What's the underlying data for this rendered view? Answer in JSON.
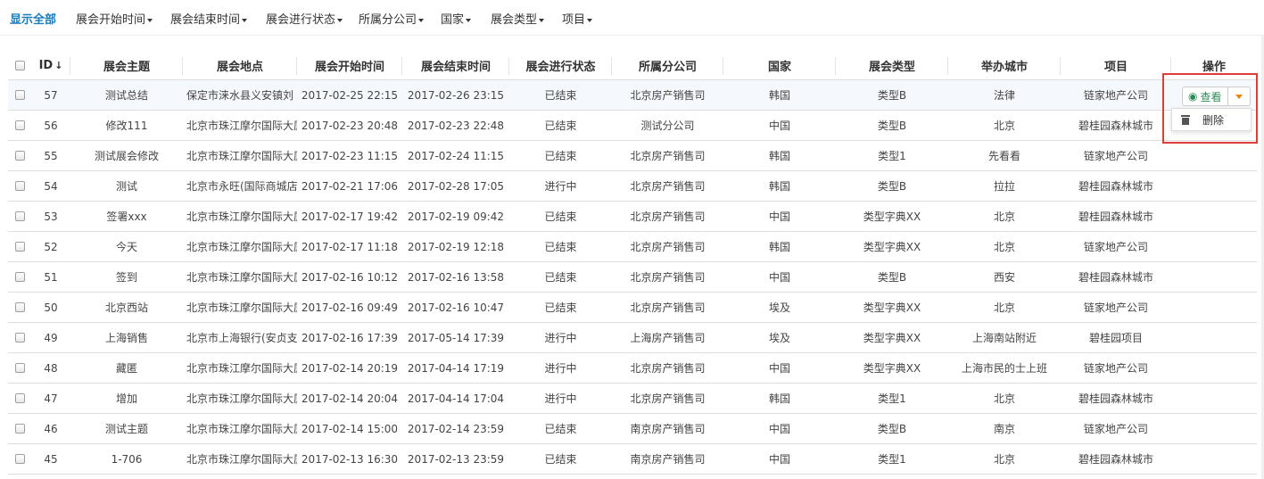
{
  "filters": {
    "show_all": "显示全部",
    "start_time": "展会开始时间",
    "end_time": "展会结束时间",
    "status": "展会进行状态",
    "branch": "所属分公司",
    "country": "国家",
    "type": "展会类型",
    "project": "项目"
  },
  "table": {
    "headers": {
      "id": "ID",
      "theme": "展会主题",
      "location": "展会地点",
      "start": "展会开始时间",
      "end": "展会结束时间",
      "status": "展会进行状态",
      "branch": "所属分公司",
      "country": "国家",
      "type": "展会类型",
      "city": "举办城市",
      "project": "项目",
      "operation": "操作"
    },
    "rows": [
      {
        "id": "57",
        "theme": "测试总结",
        "location": "保定市涞水县义安镇刘",
        "start": "2017-02-25 22:15",
        "end": "2017-02-26 23:15",
        "status": "已结束",
        "branch": "北京房产销售司",
        "country": "韩国",
        "type": "类型B",
        "city": "法律",
        "project": "链家地产公司"
      },
      {
        "id": "56",
        "theme": "修改111",
        "location": "北京市珠江摩尔国际大厦",
        "start": "2017-02-23 20:48",
        "end": "2017-02-23 22:48",
        "status": "已结束",
        "branch": "测试分公司",
        "country": "中国",
        "type": "类型B",
        "city": "北京",
        "project": "碧桂园森林城市"
      },
      {
        "id": "55",
        "theme": "测试展会修改",
        "location": "北京市珠江摩尔国际大厦",
        "start": "2017-02-23 11:15",
        "end": "2017-02-24 11:15",
        "status": "已结束",
        "branch": "北京房产销售司",
        "country": "韩国",
        "type": "类型1",
        "city": "先看看",
        "project": "链家地产公司"
      },
      {
        "id": "54",
        "theme": "测试",
        "location": "北京市永旺(国际商城店",
        "start": "2017-02-21 17:06",
        "end": "2017-02-28 17:05",
        "status": "进行中",
        "branch": "北京房产销售司",
        "country": "韩国",
        "type": "类型B",
        "city": "拉拉",
        "project": "碧桂园森林城市"
      },
      {
        "id": "53",
        "theme": "签署xxx",
        "location": "北京市珠江摩尔国际大厦",
        "start": "2017-02-17 19:42",
        "end": "2017-02-19 09:42",
        "status": "已结束",
        "branch": "北京房产销售司",
        "country": "中国",
        "type": "类型字典XX",
        "city": "北京",
        "project": "碧桂园森林城市"
      },
      {
        "id": "52",
        "theme": "今天",
        "location": "北京市珠江摩尔国际大厦",
        "start": "2017-02-17 11:18",
        "end": "2017-02-19 12:18",
        "status": "已结束",
        "branch": "北京房产销售司",
        "country": "韩国",
        "type": "类型字典XX",
        "city": "北京",
        "project": "链家地产公司"
      },
      {
        "id": "51",
        "theme": "签到",
        "location": "北京市珠江摩尔国际大厦",
        "start": "2017-02-16 10:12",
        "end": "2017-02-16 13:58",
        "status": "已结束",
        "branch": "北京房产销售司",
        "country": "中国",
        "type": "类型B",
        "city": "西安",
        "project": "碧桂园森林城市"
      },
      {
        "id": "50",
        "theme": "北京西站",
        "location": "北京市珠江摩尔国际大厦",
        "start": "2017-02-16 09:49",
        "end": "2017-02-16 10:47",
        "status": "已结束",
        "branch": "北京房产销售司",
        "country": "埃及",
        "type": "类型字典XX",
        "city": "北京",
        "project": "链家地产公司"
      },
      {
        "id": "49",
        "theme": "上海销售",
        "location": "北京市上海银行(安贞支",
        "start": "2017-02-16 17:39",
        "end": "2017-05-14 17:39",
        "status": "进行中",
        "branch": "上海房产销售司",
        "country": "埃及",
        "type": "类型字典XX",
        "city": "上海南站附近",
        "project": "碧桂园项目"
      },
      {
        "id": "48",
        "theme": "藏匿",
        "location": "北京市珠江摩尔国际大厦",
        "start": "2017-02-14 20:19",
        "end": "2017-04-14 17:19",
        "status": "进行中",
        "branch": "北京房产销售司",
        "country": "中国",
        "type": "类型字典XX",
        "city": "上海市民的士上班",
        "project": "链家地产公司"
      },
      {
        "id": "47",
        "theme": "增加",
        "location": "北京市珠江摩尔国际大厦",
        "start": "2017-02-14 20:04",
        "end": "2017-04-14 17:04",
        "status": "进行中",
        "branch": "北京房产销售司",
        "country": "韩国",
        "type": "类型1",
        "city": "北京",
        "project": "碧桂园森林城市"
      },
      {
        "id": "46",
        "theme": "测试主题",
        "location": "北京市珠江摩尔国际大厦",
        "start": "2017-02-14 15:00",
        "end": "2017-02-14 23:59",
        "status": "已结束",
        "branch": "南京房产销售司",
        "country": "中国",
        "type": "类型B",
        "city": "南京",
        "project": "链家地产公司"
      },
      {
        "id": "45",
        "theme": "1-706",
        "location": "北京市珠江摩尔国际大厦",
        "start": "2017-02-13 16:30",
        "end": "2017-02-13 23:59",
        "status": "已结束",
        "branch": "南京房产销售司",
        "country": "中国",
        "type": "类型1",
        "city": "北京",
        "project": "碧桂园森林城市"
      }
    ]
  },
  "actions": {
    "view_label": "查看",
    "delete_label": "删除",
    "view_icon": "eye-icon",
    "toggle_icon": "caret-down-icon",
    "delete_icon": "trash-icon",
    "toggle_color": "#e8860c",
    "highlight_color": "#e03b3b"
  }
}
